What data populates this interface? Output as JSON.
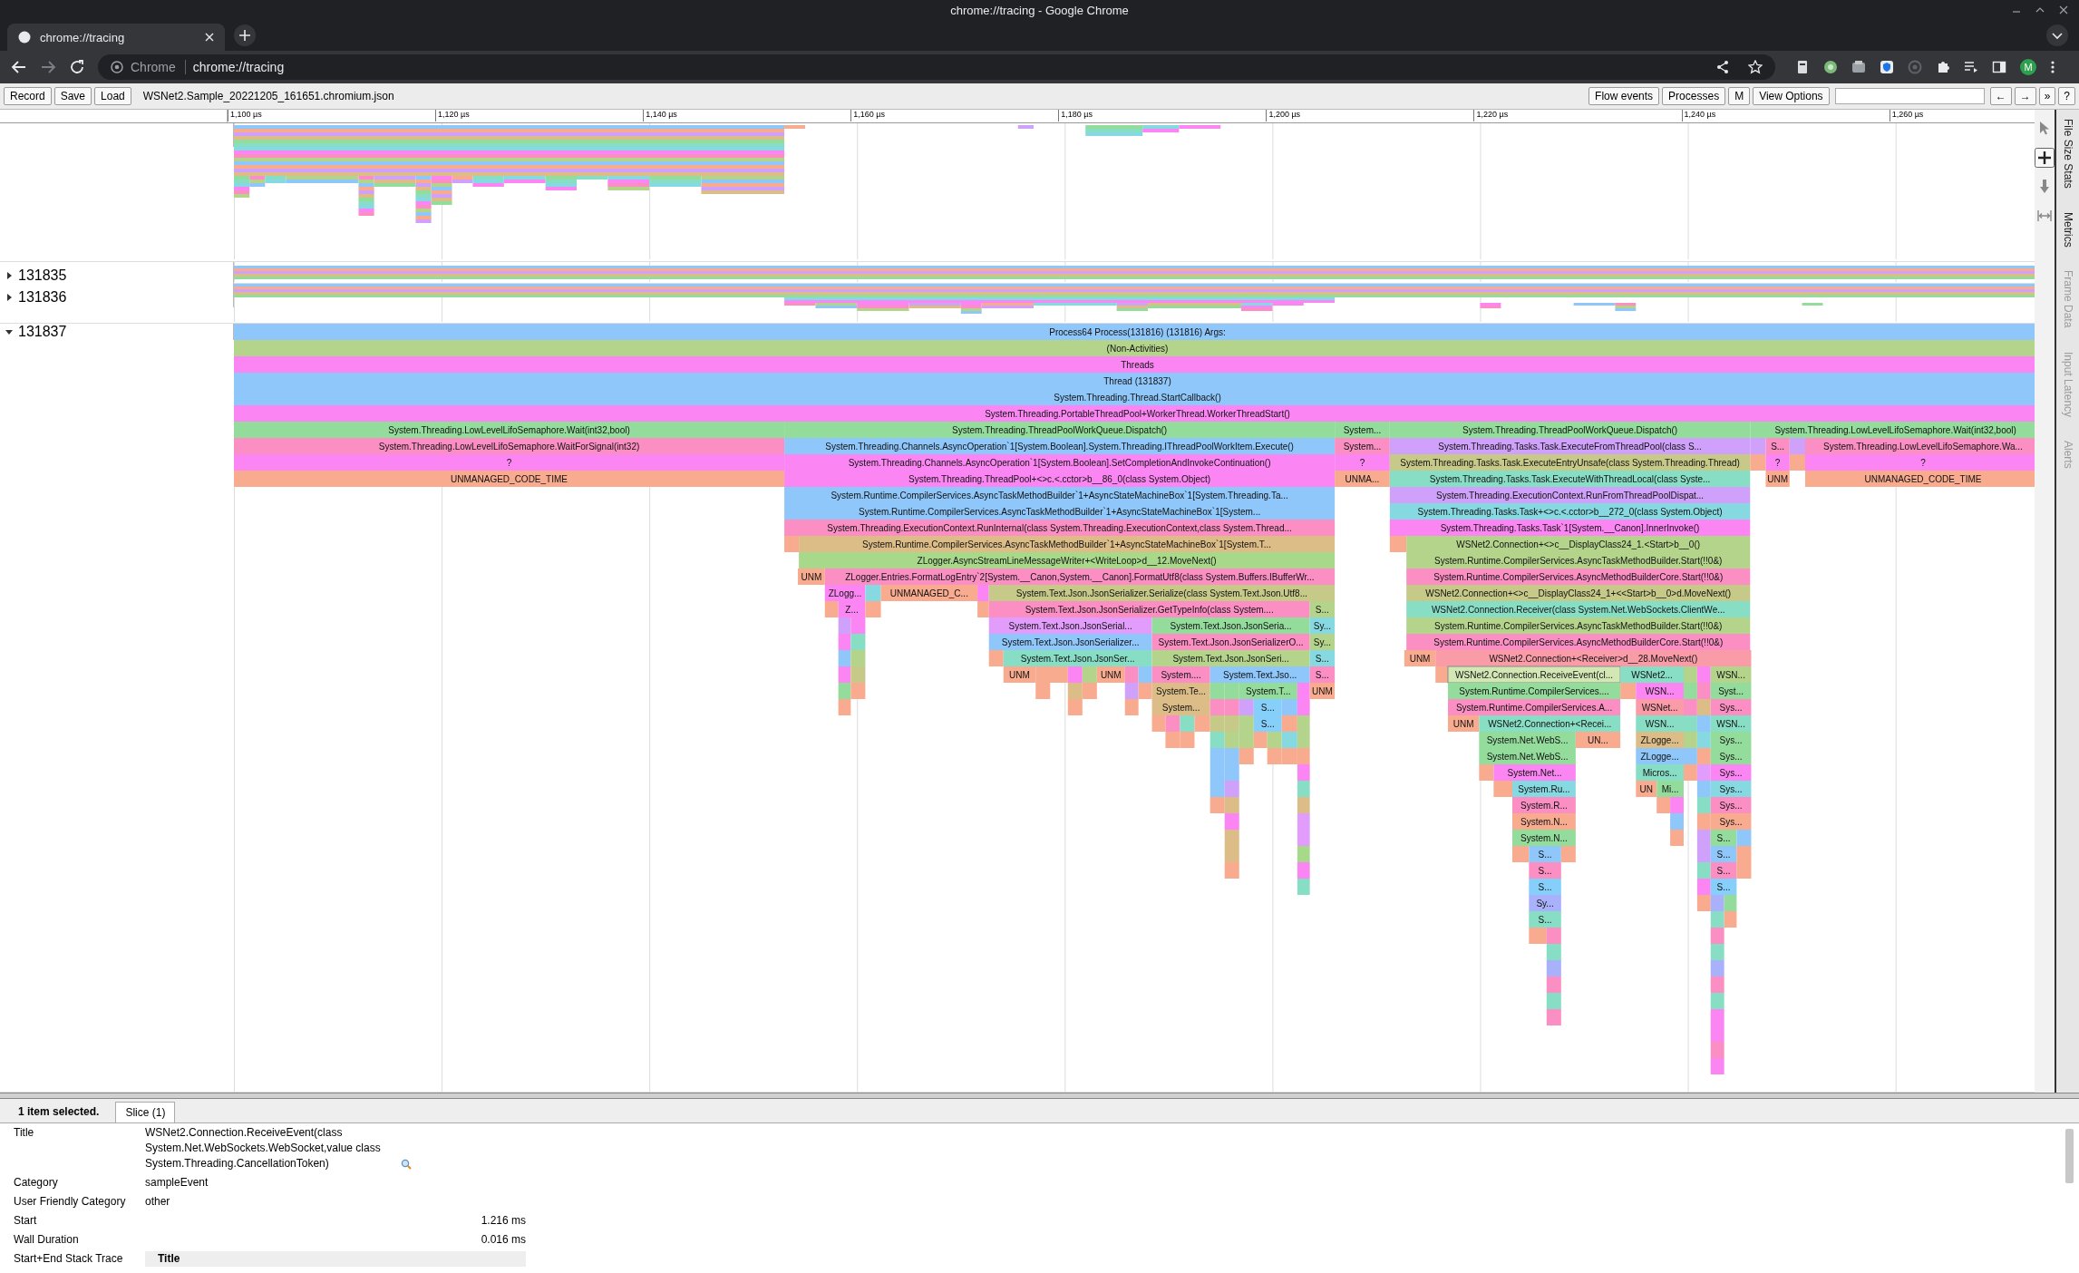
{
  "window": {
    "title": "chrome://tracing - Google Chrome"
  },
  "browser_tabs": [
    {
      "title": "chrome://tracing",
      "selected": true
    }
  ],
  "toolbar": {
    "site_label": "Chrome",
    "url": "chrome://tracing",
    "profile_initial": "M"
  },
  "tracing_toolbar": {
    "buttons_left": [
      "Record",
      "Save",
      "Load"
    ],
    "filename": "WSNet2.Sample_20221205_161651.chromium.json",
    "buttons_right": [
      "Flow events",
      "Processes",
      "M",
      "View Options"
    ],
    "nav_buttons": [
      "←",
      "→",
      "»",
      "?"
    ]
  },
  "nav_tools": [
    {
      "kind": "select",
      "selected": false
    },
    {
      "kind": "zoom",
      "selected": true
    },
    {
      "kind": "pan",
      "selected": false
    },
    {
      "kind": "timing",
      "selected": false
    }
  ],
  "side_tabs": [
    {
      "label": "File Size Stats",
      "disabled": false
    },
    {
      "label": "Metrics",
      "disabled": false
    },
    {
      "label": "Frame Data",
      "disabled": true
    },
    {
      "label": "Input Latency",
      "disabled": true
    },
    {
      "label": "Alerts",
      "disabled": true
    }
  ],
  "timeline_ruler": {
    "ticks": [
      "1,100 µs",
      "1,120 µs",
      "1,140 µs",
      "1,160 µs",
      "1,180 µs",
      "1,200 µs",
      "1,220 µs",
      "1,240 µs",
      "1,260 µs"
    ]
  },
  "tracks": [
    {
      "kind": "picture"
    },
    {
      "kind": "process",
      "label": "131835",
      "expanded": false
    },
    {
      "kind": "process",
      "label": "131836",
      "expanded": false
    },
    {
      "kind": "process",
      "label": "131837",
      "expanded": true,
      "flame": {
        "rows": [
          {
            "slices": [
              {
                "label": "Process64 Process(131816) (131816) Args:",
                "color": "#8fc7fb",
                "selected": false
              }
            ]
          },
          {
            "slices": [
              {
                "label": "(Non-Activities)",
                "color": "#b4d48c",
                "selected": false
              }
            ]
          },
          {
            "slices": [
              {
                "label": "Threads",
                "color": "#fb86f3",
                "selected": false
              }
            ]
          },
          {
            "slices": [
              {
                "label": "Thread (131837)",
                "color": "#8fc7fb",
                "selected": false
              }
            ]
          },
          {
            "slices": [
              {
                "label": "System.Threading.Thread.StartCallback()",
                "color": "#8fc7fb",
                "selected": false
              }
            ]
          },
          {
            "slices": [
              {
                "label": "System.Threading.PortableThreadPool+WorkerThread.WorkerThreadStart()",
                "color": "#fb86f3",
                "selected": false
              }
            ]
          },
          {
            "slices": [
              {
                "label": "System.Threading.LowLevelLifoSemaphore.Wait(int32,bool)",
                "color": "#94dc9b",
                "selected": false
              },
              {
                "label": "System.Threading.ThreadPoolWorkQueue.Dispatch()",
                "color": "#94dc9b",
                "selected": false
              },
              {
                "label": "System...",
                "color": "#94dc9b",
                "selected": false
              },
              {
                "label": "System.Threading.ThreadPoolWorkQueue.Dispatch()",
                "color": "#94dc9b",
                "selected": false
              },
              {
                "label": "System.Threading.LowLevelLifoSemaphore.Wait(int32,bool)",
                "color": "#94dc9b",
                "selected": false
              }
            ]
          },
          {
            "slices": [
              {
                "label": "System.Threading.LowLevelLifoSemaphore.WaitForSignal(int32)",
                "color": "#fb8fc3",
                "selected": false
              },
              {
                "label": "System.Threading.Channels.AsyncOperation`1[System.Boolean].System.Threading.IThreadPoolWorkItem.Execute()",
                "color": "#8fc7fb",
                "selected": false
              },
              {
                "label": "System...",
                "color": "#fb8fc3",
                "selected": false
              },
              {
                "label": "System.Threading.Tasks.Task.ExecuteFromThreadPool(class S...",
                "color": "#cfa1fb",
                "selected": false
              },
              {
                "color": "#cfa1fb",
                "selected": false
              },
              {
                "label": "S...",
                "color": "#fb8fc3",
                "selected": false
              },
              {
                "color": "#cfa1fb",
                "selected": false
              },
              {
                "label": "System.Threading.LowLevelLifoSemaphore.Wa...",
                "color": "#fb8fc3",
                "selected": false
              }
            ]
          },
          {
            "slices": [
              {
                "label": "?",
                "color": "#fb86f3",
                "selected": false
              },
              {
                "label": "System.Threading.Channels.AsyncOperation`1[System.Boolean].SetCompletionAndInvokeContinuation()",
                "color": "#fb86f3",
                "selected": false
              },
              {
                "label": "?",
                "color": "#fb86f3",
                "selected": false
              },
              {
                "label": "System.Threading.Tasks.Task.ExecuteEntryUnsafe(class System.Threading.Thread)",
                "color": "#c7c988",
                "selected": false
              },
              {
                "color": "#f8ab8f",
                "selected": false
              },
              {
                "label": "?",
                "color": "#fb86f3",
                "selected": false
              },
              {
                "color": "#f8ab8f",
                "selected": false
              },
              {
                "label": "?",
                "color": "#fb86f3",
                "selected": false
              }
            ]
          },
          {
            "slices": [
              {
                "label": "UNMANAGED_CODE_TIME",
                "color": "#f8ab8f",
                "selected": false
              },
              {
                "label": "System.Threading.ThreadPool+<>c.<.cctor>b__86_0(class System.Object)",
                "color": "#fb86f3",
                "selected": false
              },
              {
                "label": "UNMA...",
                "color": "#f8ab8f",
                "selected": false
              },
              {
                "label": "System.Threading.Tasks.Task.ExecuteWithThreadLocal(class Syste...",
                "color": "#88ddc5",
                "selected": false
              },
              {
                "label": "UNM",
                "color": "#f8ab8f",
                "selected": false
              },
              {
                "label": "UNMANAGED_CODE_TIME",
                "color": "#f8ab8f",
                "selected": false
              }
            ]
          },
          {
            "slices": [
              {
                "label": "System.Runtime.CompilerServices.AsyncTaskMethodBuilder`1+AsyncStateMachineBox`1[System.Threading.Ta...",
                "color": "#8fc7fb",
                "selected": false
              },
              {
                "label": "System.Threading.ExecutionContext.RunFromThreadPoolDispat...",
                "color": "#cfa1fb",
                "selected": false
              }
            ]
          },
          {
            "slices": [
              {
                "label": "System.Runtime.CompilerServices.AsyncTaskMethodBuilder`1+AsyncStateMachineBox`1[System...",
                "color": "#8fc7fb",
                "selected": false
              },
              {
                "label": "System.Threading.Tasks.Task+<>c.<.cctor>b__272_0(class System.Object)",
                "color": "#86d9e0",
                "selected": false
              }
            ]
          },
          {
            "slices": [
              {
                "label": "System.Threading.ExecutionContext.RunInternal(class System.Threading.ExecutionContext,class System.Thread...",
                "color": "#fb8fc3",
                "selected": false
              },
              {
                "label": "System.Threading.Tasks.Task`1[System.__Canon].InnerInvoke()",
                "color": "#fb86f3",
                "selected": false
              }
            ]
          },
          {
            "slices": [
              {
                "color": "#f8ab8f",
                "selected": false
              },
              {
                "label": "System.Runtime.CompilerServices.AsyncTaskMethodBuilder`1+AsyncStateMachineBox`1[System.T...",
                "color": "#ddbd87",
                "selected": false
              },
              {
                "color": "#f8ab8f",
                "selected": false
              },
              {
                "label": "WSNet2.Connection+<>c__DisplayClass24_1.<Start>b__0()",
                "color": "#b4d48c",
                "selected": false
              }
            ]
          },
          {
            "slices": [
              {
                "label": "ZLogger.AsyncStreamLineMessageWriter+<WriteLoop>d__12.MoveNext()",
                "color": "#a8d98a",
                "selected": false
              },
              {
                "label": "System.Runtime.CompilerServices.AsyncTaskMethodBuilder.Start(!!0&)",
                "color": "#b4d48c",
                "selected": false
              }
            ]
          },
          {
            "slices": [
              {
                "label": "UNM",
                "color": "#f8ab8f",
                "selected": false
              },
              {
                "label": "ZLogger.Entries.FormatLogEntry`2[System.__Canon,System.__Canon].FormatUtf8(class System.Buffers.IBufferWr...",
                "color": "#fb8fc3",
                "selected": false
              },
              {
                "label": "System.Runtime.CompilerServices.AsyncMethodBuilderCore.Start(!!0&)",
                "color": "#fb8fc3",
                "selected": false
              }
            ]
          },
          {
            "slices": [
              {
                "label": "ZLogg...",
                "color": "#fb86f3",
                "selected": false
              },
              {
                "color": "#86d9e0",
                "selected": false
              },
              {
                "label": "UNMANAGED_C...",
                "color": "#f8ab8f",
                "selected": false
              },
              {
                "color": "#fb86f3",
                "selected": false
              },
              {
                "label": "System.Text.Json.JsonSerializer.Serialize(class System.Text.Json.Utf8...",
                "color": "#c7c988",
                "selected": false
              },
              {
                "label": "WSNet2.Connection+<>c__DisplayClass24_1+<<Start>b__0>d.MoveNext()",
                "color": "#c7c988",
                "selected": false
              }
            ]
          },
          {
            "slices": [
              {
                "color": "#f8ab8f",
                "selected": false
              },
              {
                "label": "Z...",
                "color": "#fb86f3",
                "selected": false
              },
              {
                "color": "#f8ab8f",
                "selected": false
              },
              {
                "color": "#f8ab8f",
                "selected": false
              },
              {
                "label": "System.Text.Json.JsonSerializer.GetTypeInfo(class System....",
                "color": "#fb8fc3",
                "selected": false
              },
              {
                "label": "S...",
                "color": "#b4d48c",
                "selected": false
              },
              {
                "label": "WSNet2.Connection.Receiver(class System.Net.WebSockets.ClientWe...",
                "color": "#88ddc5",
                "selected": false
              }
            ]
          },
          {
            "slices": [
              {
                "color": "#cfa1fb",
                "selected": false
              },
              {
                "color": "#fb86f3",
                "selected": false
              },
              {
                "label": "System.Text.Json.JsonSerial...",
                "color": "#e29cfb",
                "selected": false
              },
              {
                "label": "System.Text.Json.JsonSeria...",
                "color": "#94dc9b",
                "selected": false
              },
              {
                "label": "Sy...",
                "color": "#86d9e0",
                "selected": false
              },
              {
                "label": "System.Runtime.CompilerServices.AsyncTaskMethodBuilder.Start(!!0&)",
                "color": "#b4d48c",
                "selected": false
              }
            ]
          },
          {
            "slices": [
              {
                "color": "#fb86f3",
                "selected": false
              },
              {
                "color": "#88ddc5",
                "selected": false
              },
              {
                "label": "System.Text.Json.JsonSerializer...",
                "color": "#8fc7fb",
                "selected": false
              },
              {
                "label": "System.Text.Json.JsonSerializerO...",
                "color": "#fb8fc3",
                "selected": false
              },
              {
                "label": "Sy...",
                "color": "#b4d48c",
                "selected": false
              },
              {
                "label": "System.Runtime.CompilerServices.AsyncMethodBuilderCore.Start(!!0&)",
                "color": "#fb8fc3",
                "selected": false
              }
            ]
          },
          {
            "slices": [
              {
                "color": "#8fc7fb",
                "selected": false
              },
              {
                "color": "#b4d48c",
                "selected": false
              },
              {
                "color": "#f8ab8f",
                "selected": false
              },
              {
                "label": "System.Text.Json.JsonSer...",
                "color": "#88ddc5",
                "selected": false
              },
              {
                "label": "System.Text.Json.JsonSeri...",
                "color": "#b4d48c",
                "selected": false
              },
              {
                "label": "S...",
                "color": "#86d9e0",
                "selected": false
              },
              {
                "label": "UNM",
                "color": "#f8ab8f",
                "selected": false
              },
              {
                "label": "WSNet2.Connection+<Receiver>d__28.MoveNext()",
                "color": "#fa9ba8",
                "selected": false
              }
            ]
          },
          {
            "slices": [
              {
                "color": "#fb86f3",
                "selected": false
              },
              {
                "color": "#c7c988",
                "selected": false
              },
              {
                "label": "UNM",
                "color": "#f8ab8f",
                "selected": false
              },
              {
                "color": "#f8ab8f",
                "selected": false
              },
              {
                "color": "#fb86f3",
                "selected": false
              },
              {
                "color": "#b4d48c",
                "selected": false
              },
              {
                "label": "UNM",
                "color": "#f8ab8f",
                "selected": false
              },
              {
                "color": "#fb8fc3",
                "selected": false
              },
              {
                "color": "#8fc7fb",
                "selected": false
              },
              {
                "label": "System....",
                "color": "#fb8fc3",
                "selected": false
              },
              {
                "label": "System.Text.Jso...",
                "color": "#8fc7fb",
                "selected": false
              },
              {
                "label": "S...",
                "color": "#fb8fc3",
                "selected": false
              },
              {
                "color": "#f8ab8f",
                "selected": false
              },
              {
                "label": "WSNet2.Connection.ReceiveEvent(cl...",
                "color": "#d3e7b5",
                "selected": true
              },
              {
                "label": "WSNet2...",
                "color": "#88ddc5",
                "selected": false
              },
              {
                "color": "#b4d48c",
                "selected": false
              },
              {
                "color": "#fb86f3",
                "selected": false
              },
              {
                "label": "WSN...",
                "color": "#b4d48c",
                "selected": false
              }
            ]
          },
          {
            "slices": [
              {
                "color": "#94dc9b",
                "selected": false
              },
              {
                "color": "#f8ab8f",
                "selected": false
              },
              {
                "color": "#f8ab8f",
                "selected": false
              },
              {
                "color": "#ddbd87",
                "selected": false
              },
              {
                "color": "#f8ab8f",
                "selected": false
              },
              {
                "color": "#cfa1fb",
                "selected": false
              },
              {
                "color": "#f8ab8f",
                "selected": false
              },
              {
                "label": "System.Te...",
                "color": "#ddbd87",
                "selected": false
              },
              {
                "color": "#94dc9b",
                "selected": false
              },
              {
                "color": "#94dc9b",
                "selected": false
              },
              {
                "label": "System.T...",
                "color": "#94dc9b",
                "selected": false
              },
              {
                "color": "#fb86f3",
                "selected": false
              },
              {
                "label": "UNM",
                "color": "#f8ab8f",
                "selected": false
              },
              {
                "label": "System.Runtime.CompilerServices....",
                "color": "#94dc9b",
                "selected": false
              },
              {
                "color": "#f8ab8f",
                "selected": false
              },
              {
                "label": "WSN...",
                "color": "#fb86f3",
                "selected": false
              },
              {
                "color": "#94dc9b",
                "selected": false
              },
              {
                "color": "#fb8fc3",
                "selected": false
              },
              {
                "label": "Syst...",
                "color": "#94dc9b",
                "selected": false
              }
            ]
          },
          {
            "slices": [
              {
                "color": "#f8ab8f",
                "selected": false
              },
              {
                "color": "#f8ab8f",
                "selected": false
              },
              {
                "color": "#f8ab8f",
                "selected": false
              },
              {
                "label": "System...",
                "color": "#ddbd87",
                "selected": false
              },
              {
                "color": "#fb8fc3",
                "selected": false
              },
              {
                "color": "#fb8fc3",
                "selected": false
              },
              {
                "color": "#cfa1fb",
                "selected": false
              },
              {
                "label": "S...",
                "color": "#86cffb",
                "selected": false
              },
              {
                "color": "#8fc7fb",
                "selected": false
              },
              {
                "color": "#fb86f3",
                "selected": false
              },
              {
                "label": "System.Runtime.CompilerServices.A...",
                "color": "#fb8fc3",
                "selected": false
              },
              {
                "label": "WSNet...",
                "color": "#fa9ba8",
                "selected": false
              },
              {
                "color": "#fb8fc3",
                "selected": false
              },
              {
                "color": "#ddbd87",
                "selected": false
              },
              {
                "label": "Sys...",
                "color": "#fb8fc3",
                "selected": false
              }
            ]
          },
          {
            "slices": [
              {
                "color": "#f8ab8f",
                "selected": false
              },
              {
                "color": "#fb8fc3",
                "selected": false
              },
              {
                "color": "#88ddc5",
                "selected": false
              },
              {
                "color": "#f8ab8f",
                "selected": false
              },
              {
                "color": "#c7c988",
                "selected": false
              },
              {
                "color": "#c7c988",
                "selected": false
              },
              {
                "color": "#b4d48c",
                "selected": false
              },
              {
                "label": "S...",
                "color": "#86cffb",
                "selected": false
              },
              {
                "color": "#f8ab8f",
                "selected": false
              },
              {
                "color": "#b4d48c",
                "selected": false
              },
              {
                "label": "UNM",
                "color": "#f8ab8f",
                "selected": false
              },
              {
                "label": "WSNet2.Connection+<Recei...",
                "color": "#88ddc5",
                "selected": false
              },
              {
                "label": "WSN...",
                "color": "#88ddc5",
                "selected": false
              },
              {
                "color": "#88ddc5",
                "selected": false
              },
              {
                "color": "#8fc7fb",
                "selected": false
              },
              {
                "label": "WSN...",
                "color": "#88ddc5",
                "selected": false
              }
            ]
          },
          {
            "slices": [
              {
                "color": "#f8ab8f",
                "selected": false
              },
              {
                "color": "#f8ab8f",
                "selected": false
              },
              {
                "color": "#88ddc5",
                "selected": false
              },
              {
                "color": "#b4d48c",
                "selected": false
              },
              {
                "color": "#b4d48c",
                "selected": false
              },
              {
                "color": "#f8ab8f",
                "selected": false
              },
              {
                "color": "#b4d48c",
                "selected": false
              },
              {
                "color": "#86d9e0",
                "selected": false
              },
              {
                "color": "#b4d48c",
                "selected": false
              },
              {
                "label": "System.Net.WebS...",
                "color": "#94dc9b",
                "selected": false
              },
              {
                "label": "UN...",
                "color": "#f8ab8f",
                "selected": false
              },
              {
                "label": "ZLogge...",
                "color": "#ddbd87",
                "selected": false
              },
              {
                "color": "#b4d48c",
                "selected": false
              },
              {
                "color": "#86d9e0",
                "selected": false
              },
              {
                "label": "Sys...",
                "color": "#94dc9b",
                "selected": false
              }
            ]
          },
          {
            "slices": [
              {
                "color": "#8fc7fb",
                "selected": false
              },
              {
                "color": "#8fc7fb",
                "selected": false
              },
              {
                "color": "#f8ab8f",
                "selected": false
              },
              {
                "color": "#f8ab8f",
                "selected": false
              },
              {
                "color": "#f8ab8f",
                "selected": false
              },
              {
                "color": "#f8ab8f",
                "selected": false
              },
              {
                "label": "System.Net.WebS...",
                "color": "#94dc9b",
                "selected": false
              },
              {
                "label": "ZLogge...",
                "color": "#8fc7fb",
                "selected": false
              },
              {
                "color": "#8fc7fb",
                "selected": false
              },
              {
                "color": "#f8ab8f",
                "selected": false
              },
              {
                "label": "Sys...",
                "color": "#94dc9b",
                "selected": false
              }
            ]
          },
          {
            "slices": [
              {
                "color": "#8fc7fb",
                "selected": false
              },
              {
                "color": "#8fc7fb",
                "selected": false
              },
              {
                "color": "#fb86f3",
                "selected": false
              },
              {
                "color": "#f8ab8f",
                "selected": false
              },
              {
                "label": "System.Net...",
                "color": "#fb86f3",
                "selected": false
              },
              {
                "label": "Micros...",
                "color": "#88ddc5",
                "selected": false
              },
              {
                "color": "#f8ab8f",
                "selected": false
              },
              {
                "color": "#e29cfb",
                "selected": false
              },
              {
                "label": "Sys...",
                "color": "#fb86f3",
                "selected": false
              }
            ]
          },
          {
            "slices": [
              {
                "color": "#8fc7fb",
                "selected": false
              },
              {
                "color": "#cfa1fb",
                "selected": false
              },
              {
                "color": "#88ddc5",
                "selected": false
              },
              {
                "color": "#f8ab8f",
                "selected": false
              },
              {
                "label": "System.Ru...",
                "color": "#86d9e0",
                "selected": false
              },
              {
                "label": "UN",
                "color": "#f8ab8f",
                "selected": false
              },
              {
                "label": "Mi...",
                "color": "#94dc9b",
                "selected": false
              },
              {
                "color": "#8fc7fb",
                "selected": false
              },
              {
                "label": "Sys...",
                "color": "#86d9e0",
                "selected": false
              }
            ]
          },
          {
            "slices": [
              {
                "color": "#f8ab8f",
                "selected": false
              },
              {
                "color": "#ddbd87",
                "selected": false
              },
              {
                "color": "#ddbd87",
                "selected": false
              },
              {
                "label": "System.R...",
                "color": "#fb8fc3",
                "selected": false
              },
              {
                "color": "#f8ab8f",
                "selected": false
              },
              {
                "color": "#fb86f3",
                "selected": false
              },
              {
                "color": "#88ddc5",
                "selected": false
              },
              {
                "label": "Sys...",
                "color": "#fb8fc3",
                "selected": false
              }
            ]
          },
          {
            "slices": [
              {
                "color": "#fb86f3",
                "selected": false
              },
              {
                "color": "#e29cfb",
                "selected": false
              },
              {
                "label": "System.N...",
                "color": "#f8ab8f",
                "selected": false
              },
              {
                "color": "#8fc7fb",
                "selected": false
              },
              {
                "color": "#f8ab8f",
                "selected": false
              },
              {
                "label": "Sys...",
                "color": "#f8ab8f",
                "selected": false
              }
            ]
          },
          {
            "slices": [
              {
                "color": "#ddbd87",
                "selected": false
              },
              {
                "color": "#e29cfb",
                "selected": false
              },
              {
                "label": "System.N...",
                "color": "#94dc9b",
                "selected": false
              },
              {
                "color": "#f8ab8f",
                "selected": false
              },
              {
                "color": "#cfa1fb",
                "selected": false
              },
              {
                "label": "S...",
                "color": "#94dc9b",
                "selected": false
              },
              {
                "color": "#8fc7fb",
                "selected": false
              }
            ]
          },
          {
            "slices": [
              {
                "color": "#ddbd87",
                "selected": false
              },
              {
                "color": "#a8d98a",
                "selected": false
              },
              {
                "color": "#f8ab8f",
                "selected": false
              },
              {
                "label": "S...",
                "color": "#8fc7fb",
                "selected": false
              },
              {
                "color": "#f8ab8f",
                "selected": false
              },
              {
                "color": "#cfa1fb",
                "selected": false
              },
              {
                "label": "S...",
                "color": "#8fc7fb",
                "selected": false
              },
              {
                "color": "#f8ab8f",
                "selected": false
              }
            ]
          },
          {
            "slices": [
              {
                "color": "#f8ab8f",
                "selected": false
              },
              {
                "color": "#fb86f3",
                "selected": false
              },
              {
                "label": "S...",
                "color": "#fb8fc3",
                "selected": false
              },
              {
                "color": "#88ddc5",
                "selected": false
              },
              {
                "label": "S...",
                "color": "#fb8fc3",
                "selected": false
              },
              {
                "color": "#f8ab8f",
                "selected": false
              }
            ]
          },
          {
            "slices": [
              {
                "color": "#88ddc5",
                "selected": false
              },
              {
                "label": "S...",
                "color": "#86cffb",
                "selected": false
              },
              {
                "color": "#fb86f3",
                "selected": false
              },
              {
                "label": "S...",
                "color": "#86cffb",
                "selected": false
              }
            ]
          },
          {
            "slices": [
              {
                "label": "Sy...",
                "color": "#a9b1fb",
                "selected": false
              },
              {
                "color": "#f8ab8f",
                "selected": false
              },
              {
                "color": "#a9b1fb",
                "selected": false
              },
              {
                "color": "#94dc9b",
                "selected": false
              }
            ]
          },
          {
            "slices": [
              {
                "label": "S...",
                "color": "#88ddc5",
                "selected": false
              },
              {
                "color": "#88ddc5",
                "selected": false
              },
              {
                "color": "#f8ab8f",
                "selected": false
              }
            ]
          },
          {
            "slices": [
              {
                "color": "#f8ab8f",
                "selected": false
              },
              {
                "color": "#fb8fc3",
                "selected": false
              },
              {
                "color": "#fb8fc3",
                "selected": false
              }
            ]
          },
          {
            "slices": [
              {
                "color": "#88ddc5",
                "selected": false
              },
              {
                "color": "#88ddc5",
                "selected": false
              }
            ]
          },
          {
            "slices": [
              {
                "color": "#a9b1fb",
                "selected": false
              },
              {
                "color": "#a9b1fb",
                "selected": false
              }
            ]
          },
          {
            "slices": [
              {
                "color": "#fb8fc3",
                "selected": false
              },
              {
                "color": "#fb8fc3",
                "selected": false
              }
            ]
          },
          {
            "slices": [
              {
                "color": "#88ddc5",
                "selected": false
              },
              {
                "color": "#88ddc5",
                "selected": false
              }
            ]
          },
          {
            "slices": [
              {
                "color": "#fb8fc3",
                "selected": false
              },
              {
                "color": "#fb86f3",
                "selected": false
              }
            ]
          },
          {
            "slices": [
              {
                "color": "#fb86f3",
                "selected": false
              }
            ]
          },
          {
            "slices": [
              {
                "color": "#fb8fc3",
                "selected": false
              }
            ]
          },
          {
            "slices": [
              {
                "color": "#fb86f3",
                "selected": false
              }
            ]
          }
        ]
      }
    }
  ],
  "details": {
    "summary": "1 item selected.",
    "tabs": [
      {
        "label": "Slice (1)",
        "selected": true
      }
    ],
    "rows": [
      {
        "kind": "title",
        "label": "Title",
        "value": "WSNet2.Connection.ReceiveEvent(class System.Net.WebSockets.WebSocket,value class System.Threading.CancellationToken)"
      },
      {
        "kind": "text",
        "label": "Category",
        "value": "sampleEvent"
      },
      {
        "kind": "text",
        "label": "User Friendly Category",
        "value": "other"
      },
      {
        "kind": "number",
        "label": "Start",
        "value": "1.216 ms"
      },
      {
        "kind": "number",
        "label": "Wall Duration",
        "value": "0.016 ms"
      },
      {
        "kind": "table",
        "label": "Start+End Stack Trace",
        "columns": [
          "Title"
        ]
      }
    ]
  }
}
